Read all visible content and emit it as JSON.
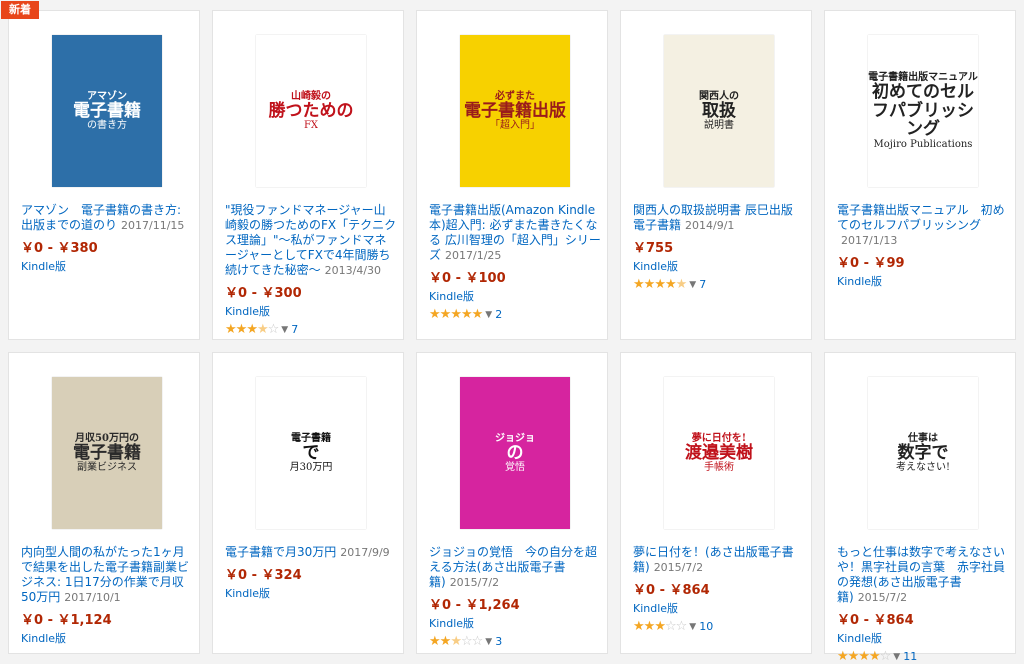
{
  "badge": "新着",
  "books": [
    {
      "cover_lines": [
        "アマゾン",
        "電子書籍",
        "の書き方"
      ],
      "cover_bg": "#2d6fa8",
      "cover_fg": "#ffffff",
      "title": "アマゾン　電子書籍の書き方: 出版までの道のり",
      "date": "2017/11/15",
      "price": "￥0 - ￥380",
      "format": "Kindle版",
      "rating": 0,
      "reviews": ""
    },
    {
      "cover_lines": [
        "山崎毅の",
        "勝つための",
        "FX"
      ],
      "cover_bg": "#ffffff",
      "cover_fg": "#c0121b",
      "title": "\"現役ファンドマネージャー山崎毅の勝つためのFX「テクニクス理論」\"〜私がファンドマネージャーとしてFXで4年間勝ち続けてきた秘密〜",
      "date": "2013/4/30",
      "price": "￥0 - ￥300",
      "format": "Kindle版",
      "rating": 3.5,
      "reviews": "7"
    },
    {
      "cover_lines": [
        "必ずまた",
        "電子書籍出版",
        "「超入門」"
      ],
      "cover_bg": "#f7d100",
      "cover_fg": "#9a1b1b",
      "title": "電子書籍出版(Amazon Kindle本)超入門: 必ずまた書きたくなる 広川智理の「超入門」シリーズ",
      "date": "2017/1/25",
      "price": "￥0 - ￥100",
      "format": "Kindle版",
      "rating": 5,
      "reviews": "2"
    },
    {
      "cover_lines": [
        "関西人の",
        "取扱",
        "説明書"
      ],
      "cover_bg": "#f4f0e2",
      "cover_fg": "#222222",
      "title": "関西人の取扱説明書 辰巳出版　電子書籍",
      "date": "2014/9/1",
      "price": "￥755",
      "format": "Kindle版",
      "rating": 4.5,
      "reviews": "7"
    },
    {
      "cover_lines": [
        "電子書籍出版マニュアル",
        "初めてのセルフパブリッシング",
        "Mojiro Publications"
      ],
      "cover_bg": "#ffffff",
      "cover_fg": "#222222",
      "title": "電子書籍出版マニュアル　初めてのセルフパブリッシング",
      "date": "2017/1/13",
      "price": "￥0 - ￥99",
      "format": "Kindle版",
      "rating": 0,
      "reviews": ""
    },
    {
      "cover_lines": [
        "月収50万円の",
        "電子書籍",
        "副業ビジネス"
      ],
      "cover_bg": "#d8cfb8",
      "cover_fg": "#2a2a2a",
      "title": "内向型人間の私がたった1ヶ月で結果を出した電子書籍副業ビジネス: 1日17分の作業で月収50万円",
      "date": "2017/10/1",
      "price": "￥0 - ￥1,124",
      "format": "Kindle版",
      "rating": 0,
      "reviews": ""
    },
    {
      "cover_lines": [
        "電子書籍",
        "で",
        "月30万円"
      ],
      "cover_bg": "#ffffff",
      "cover_fg": "#111111",
      "title": "電子書籍で月30万円",
      "date": "2017/9/9",
      "price": "￥0 - ￥324",
      "format": "Kindle版",
      "rating": 0,
      "reviews": ""
    },
    {
      "cover_lines": [
        "ジョジョ",
        "の",
        "覚悟"
      ],
      "cover_bg": "#d6249f",
      "cover_fg": "#ffffff",
      "title": "ジョジョの覚悟　今の自分を超える方法(あさ出版電子書籍)",
      "date": "2015/7/2",
      "price": "￥0 - ￥1,264",
      "format": "Kindle版",
      "rating": 2.5,
      "reviews": "3"
    },
    {
      "cover_lines": [
        "夢に日付を!",
        "渡邉美樹",
        "手帳術"
      ],
      "cover_bg": "#ffffff",
      "cover_fg": "#c0121b",
      "title": "夢に日付を！(あさ出版電子書籍)",
      "date": "2015/7/2",
      "price": "￥0 - ￥864",
      "format": "Kindle版",
      "rating": 3,
      "reviews": "10"
    },
    {
      "cover_lines": [
        "仕事は",
        "数字で",
        "考えなさい!"
      ],
      "cover_bg": "#ffffff",
      "cover_fg": "#222222",
      "title": "もっと仕事は数字で考えなさいや！黒字社員の言葉　赤字社員の発想(あさ出版電子書籍)",
      "date": "2015/7/2",
      "price": "￥0 - ￥864",
      "format": "Kindle版",
      "rating": 4,
      "reviews": "11"
    }
  ]
}
